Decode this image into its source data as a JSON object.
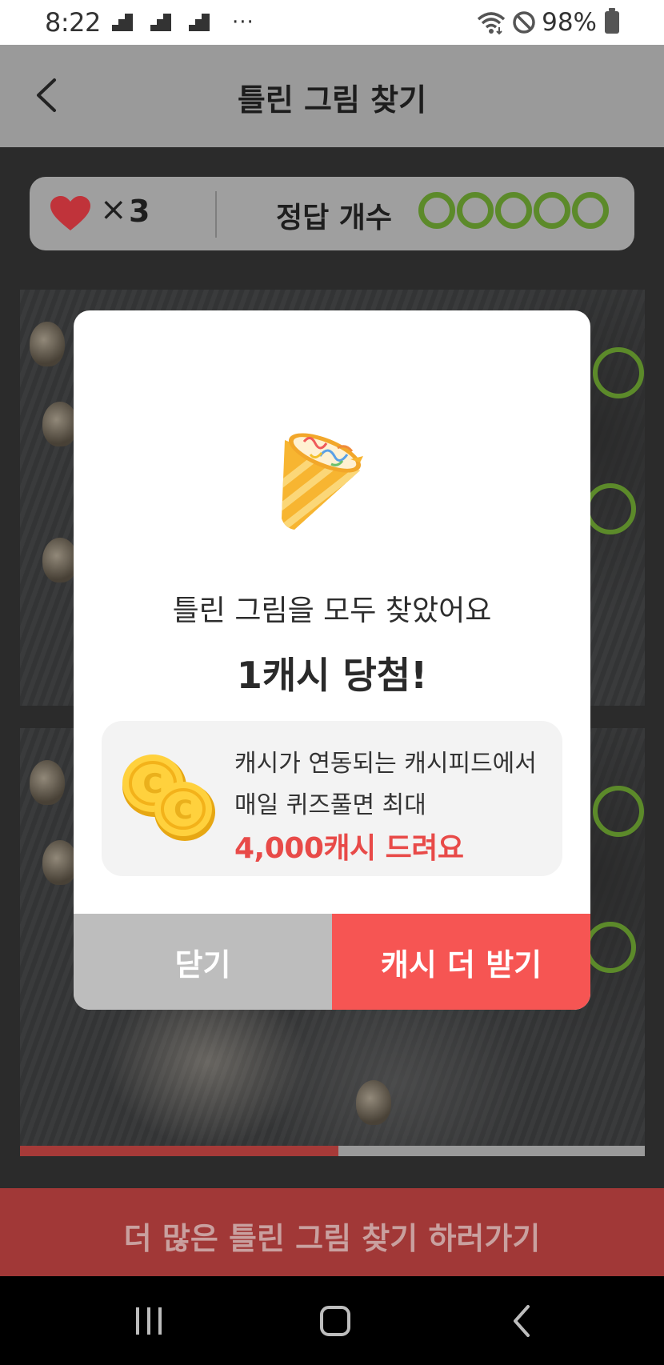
{
  "status_bar": {
    "time": "8:22",
    "overflow_dots": "···",
    "battery_percent": "98%"
  },
  "header": {
    "title": "틀린 그림 찾기",
    "back_icon": "chevron-left-icon"
  },
  "score_panel": {
    "lives_symbol": "×",
    "lives_count": "3",
    "answers_label": "정답 개수",
    "answer_slots_total": 5,
    "answer_color": "#5c8a2a",
    "heart_color": "#c0333a"
  },
  "progress": {
    "fraction": 0.51,
    "fill_color": "#a63a38"
  },
  "bottom_cta": {
    "label": "더 많은 틀린 그림 찾기 하러가기"
  },
  "dialog": {
    "icon": "party-popper-icon",
    "message": "틀린 그림을 모두 찾았어요",
    "prize": "1캐시 당첨!",
    "promo": {
      "icon": "coins-icon",
      "line1": "캐시가 연동되는 캐시피드에서",
      "line2": "매일 퀴즈풀면 최대",
      "highlight": "4,000캐시 드려요",
      "highlight_color": "#e84a48"
    },
    "close_label": "닫기",
    "more_cash_label": "캐시 더 받기",
    "accent_color": "#f65553"
  }
}
